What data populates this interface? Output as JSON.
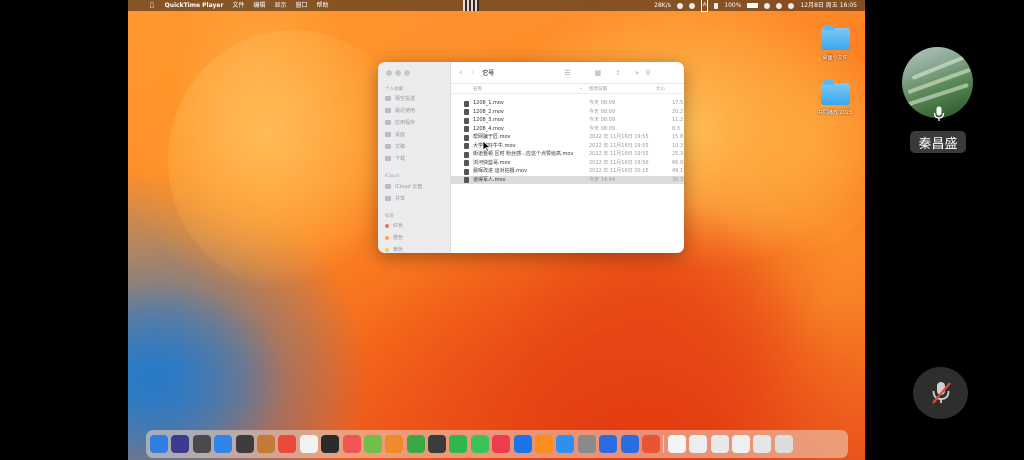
{
  "menubar": {
    "apple_icon": "apple-icon",
    "app_name": "QuickTime Player",
    "menus": [
      "文件",
      "编辑",
      "显示",
      "窗口",
      "帮助"
    ],
    "status_speed": "28K/s",
    "battery": "100%",
    "clock": "12月8日 周五 16:05"
  },
  "desktop_icons": [
    {
      "label": "桌面小文件"
    },
    {
      "label": "共同播放 2023"
    }
  ],
  "finder": {
    "title": "它号",
    "sidebar": {
      "favorites_header": "个人收藏",
      "favorites": [
        "隔空投送",
        "最近使用",
        "应用程序",
        "桌面",
        "文稿",
        "下载"
      ],
      "icloud_header": "iCloud",
      "icloud": [
        "iCloud 云盘",
        "共享"
      ],
      "tags_header": "标签",
      "tags": [
        {
          "label": "红色",
          "color": "#f0736e"
        },
        {
          "label": "橙色",
          "color": "#f5a84a"
        },
        {
          "label": "黄色",
          "color": "#f5d04a"
        }
      ]
    },
    "columns": {
      "name": "名称",
      "date": "修改日期",
      "size": "大小"
    },
    "files": [
      {
        "name": "1208_1.mov",
        "date": "今天 08:09",
        "size": "17.5"
      },
      {
        "name": "1208_2.mov",
        "date": "今天 08:09",
        "size": "20.2"
      },
      {
        "name": "1208_3.mov",
        "date": "今天 08:09",
        "size": "11.2"
      },
      {
        "name": "1208_4.mov",
        "date": "今天 08:09",
        "size": "8.3"
      },
      {
        "name": "帮网骗于匠.mov",
        "date": "2022 年 11月16日 19:55",
        "size": "15.8"
      },
      {
        "name": "大学和好牛牛.mov",
        "date": "2022 年 11月16日 19:55",
        "size": "10.3"
      },
      {
        "name": "街道整顿 区时 粉丝感...应这个点赞给高.mov",
        "date": "2022 年 11月16日 19:55",
        "size": "25.3"
      },
      {
        "name": "浏河快篮哥.mov",
        "date": "2022 年 11月16日 19:56",
        "size": "66.0"
      },
      {
        "name": "晨晖改进 运对拍摄.mov",
        "date": "2022 年 11月16日 20:15",
        "size": "49.1"
      },
      {
        "name": "道得军人.mov",
        "date": "今天 14:44",
        "size": "30.3"
      }
    ]
  },
  "participant": {
    "name": "秦昌盛",
    "mic_icon": "microphone-icon"
  },
  "controls": {
    "mute_icon": "microphone-muted-icon",
    "mute_color": "#e04a3a"
  },
  "dock_colors": [
    "#2e7fe0",
    "#3b3b8f",
    "#4a4a4a",
    "#2f86e8",
    "#3d3d3d",
    "#c47a36",
    "#e94a3b",
    "#f2f2f2",
    "#2b2b2b",
    "#f05656",
    "#6fbf4a",
    "#f28a2a",
    "#3aa845",
    "#3c3c3c",
    "#2fb64c",
    "#39c15a",
    "#ee3d4f",
    "#1d74e6",
    "#fb8c1d",
    "#2e8ff0",
    "#8a8a8a",
    "#2d6be0",
    "#2b6ce0",
    "#e85534",
    "#f4f4f4",
    "#ededed",
    "#e8e8e8",
    "#f0f0f0",
    "#e6e6e6",
    "#dcdcdc"
  ]
}
